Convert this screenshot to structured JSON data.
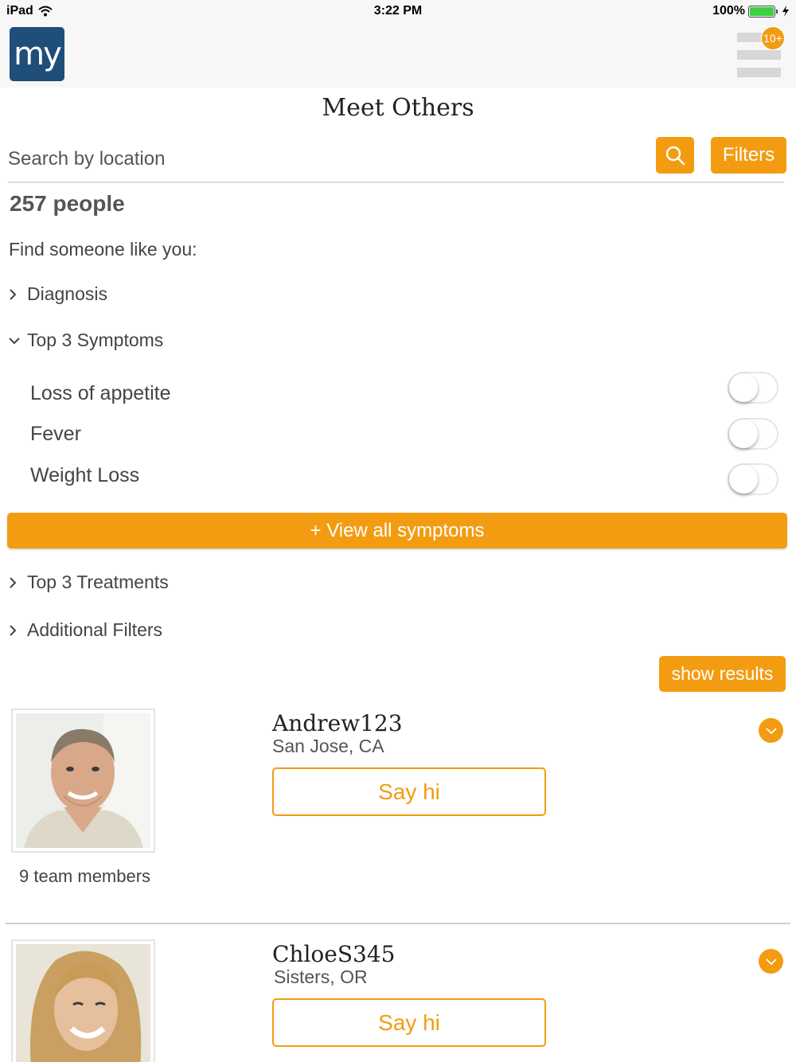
{
  "status_bar": {
    "device": "iPad",
    "time": "3:22 PM",
    "battery": "100%"
  },
  "header": {
    "logo_text": "my",
    "notification_badge": "10+"
  },
  "page": {
    "title": "Meet Others"
  },
  "search": {
    "placeholder": "Search by location",
    "filters_label": "Filters"
  },
  "results": {
    "count": "257 people",
    "find_prompt": "Find someone like you:"
  },
  "sections": {
    "diagnosis": "Diagnosis",
    "top_symptoms": "Top 3 Symptoms",
    "top_treatments": "Top 3 Treatments",
    "additional_filters": "Additional Filters"
  },
  "symptoms": [
    {
      "label": "Loss of appetite",
      "enabled": false
    },
    {
      "label": "Fever",
      "enabled": false
    },
    {
      "label": "Weight Loss",
      "enabled": false
    }
  ],
  "buttons": {
    "view_all_symptoms": "+ View all symptoms",
    "show_results": "show results",
    "say_hi": "Say hi"
  },
  "members": [
    {
      "name": "Andrew123",
      "location": "San Jose, CA",
      "team": "9 team members"
    },
    {
      "name": "ChloeS345",
      "location": "Sisters, OR"
    }
  ],
  "colors": {
    "accent": "#f39c12",
    "logo_bg": "#1f4e79"
  }
}
